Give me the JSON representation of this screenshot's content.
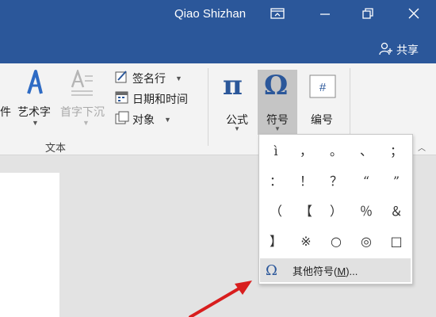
{
  "window": {
    "user_name": "Qiao Shizhan",
    "share_label": "共享"
  },
  "ribbon": {
    "partial_label": "件",
    "wordart_label": "艺术字",
    "dropcap_label": "首字下沉",
    "signature_label": "签名行",
    "datetime_label": "日期和时间",
    "object_label": "对象",
    "group_text_label": "文本",
    "formula_label": "公式",
    "symbol_label": "符号",
    "number_label": "编号"
  },
  "symbols": {
    "items": [
      "ì",
      "，",
      "。",
      "、",
      "；",
      "：",
      "！",
      "？",
      "“",
      "”",
      "（",
      "【",
      "）",
      "％",
      "＆",
      "】",
      "※",
      "○",
      "◎",
      "□"
    ],
    "more_prefix": "其他符号(",
    "more_key": "M",
    "more_suffix": ")..."
  },
  "colors": {
    "titlebar": "#2b579a",
    "ribbon_bg": "#f3f3f3",
    "active_button": "#c5c5c5",
    "arrow": "#d81e1e",
    "omega_blue": "#2b579a"
  },
  "icons": {
    "restore": "ribbon-display-icon",
    "maximize": "restore-window-icon",
    "close": "close-icon",
    "share": "person-add-icon"
  }
}
